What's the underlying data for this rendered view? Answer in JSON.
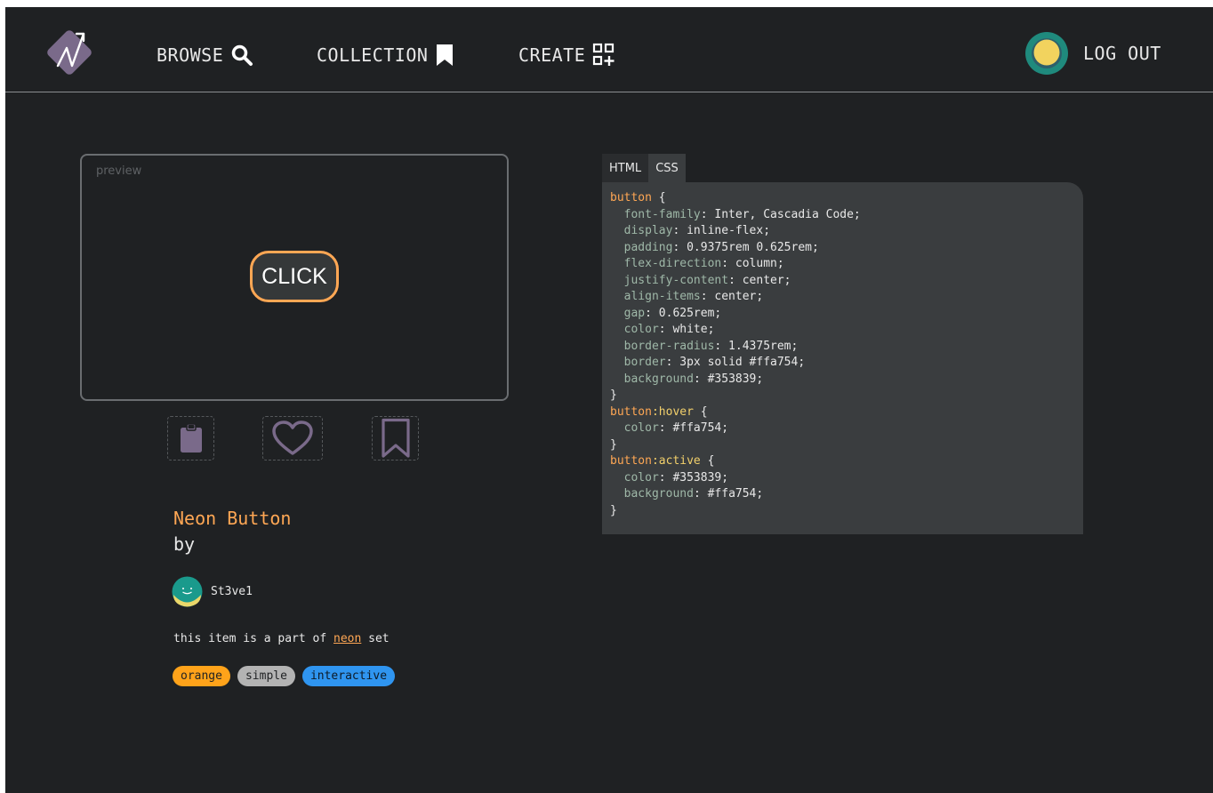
{
  "header": {
    "nav": [
      {
        "label": "BROWSE",
        "icon": "search-icon"
      },
      {
        "label": "COLLECTION",
        "icon": "bookmark-icon"
      },
      {
        "label": "CREATE",
        "icon": "add-grid-icon"
      }
    ],
    "logout_label": "LOG OUT"
  },
  "preview": {
    "label": "preview",
    "button_text": "CLICK"
  },
  "actions": [
    {
      "icon": "clipboard-icon"
    },
    {
      "icon": "heart-icon"
    },
    {
      "icon": "bookmark-outline-icon"
    }
  ],
  "item": {
    "title": "Neon Button",
    "by": "by",
    "author": "St3ve1",
    "set_prefix": "this item is a part of ",
    "set_name": "neon",
    "set_suffix": " set",
    "tags": [
      "orange",
      "simple",
      "interactive"
    ]
  },
  "code": {
    "tabs": [
      "HTML",
      "CSS"
    ],
    "active_tab": "CSS",
    "blocks": [
      {
        "selector": "button",
        "pseudo": "",
        "rules": [
          {
            "prop": "font-family",
            "value": "Inter, Cascadia Code"
          },
          {
            "prop": "display",
            "value": "inline-flex"
          },
          {
            "prop": "padding",
            "value": "0.9375rem 0.625rem"
          },
          {
            "prop": "flex-direction",
            "value": "column"
          },
          {
            "prop": "justify-content",
            "value": "center"
          },
          {
            "prop": "align-items",
            "value": "center"
          },
          {
            "prop": "gap",
            "value": "0.625rem"
          },
          {
            "prop": "color",
            "value": "white"
          },
          {
            "prop": "border-radius",
            "value": "1.4375rem"
          },
          {
            "prop": "border",
            "value": "3px solid #ffa754"
          },
          {
            "prop": "background",
            "value": "#353839"
          }
        ]
      },
      {
        "selector": "button",
        "pseudo": ":hover",
        "rules": [
          {
            "prop": "color",
            "value": "#ffa754"
          }
        ]
      },
      {
        "selector": "button",
        "pseudo": ":active",
        "rules": [
          {
            "prop": "color",
            "value": "#353839"
          },
          {
            "prop": "background",
            "value": "#ffa754"
          }
        ]
      }
    ]
  },
  "colors": {
    "background": "#1f2123",
    "accent": "#ffa754",
    "panel": "#3a3d3f",
    "icon_purple": "#7a6a8a"
  }
}
